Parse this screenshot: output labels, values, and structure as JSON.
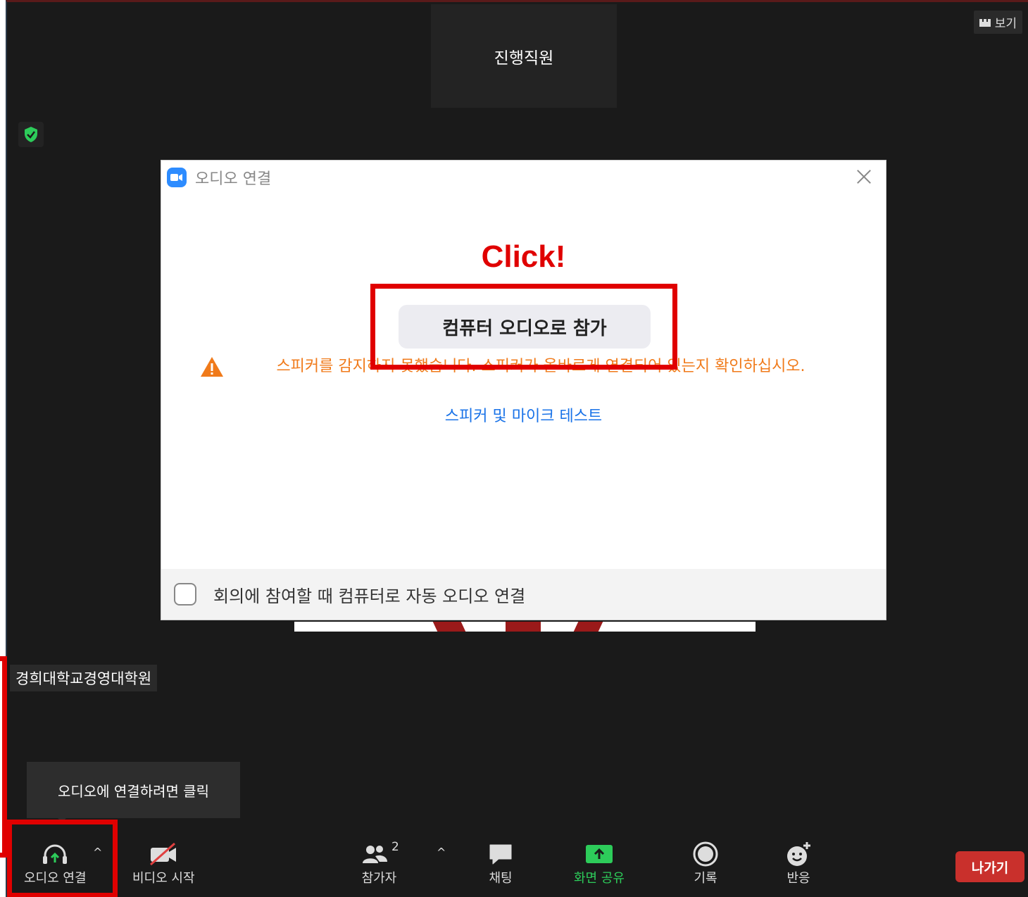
{
  "meeting": {
    "speaker_name": "진행직원",
    "view_label": "보기",
    "participant_name": "경희대학교경영대학원",
    "audio_tooltip": "오디오에 연결하려면 클릭"
  },
  "dialog": {
    "title": "오디오 연결",
    "annotation": "Click!",
    "join_button": "컴퓨터 오디오로 참가",
    "warning": "스피커를 감지하지 못했습니다. 스피커가 올바르게 연결되어 있는지 확인하십시오.",
    "test_link": "스피커 및 마이크 테스트",
    "auto_connect_label": "회의에 참여할 때 컴퓨터로 자동 오디오 연결"
  },
  "toolbar": {
    "audio": "오디오 연결",
    "video": "비디오 시작",
    "participants": "참가자",
    "participant_count": "2",
    "chat": "채팅",
    "share": "화면 공유",
    "record": "기록",
    "reactions": "반응",
    "leave": "나가기"
  },
  "colors": {
    "accent_blue": "#2d8cff",
    "share_green": "#2dcc5a",
    "warning_orange": "#f07a1a",
    "leave_red": "#c9302c",
    "highlight_red": "#e00000"
  }
}
